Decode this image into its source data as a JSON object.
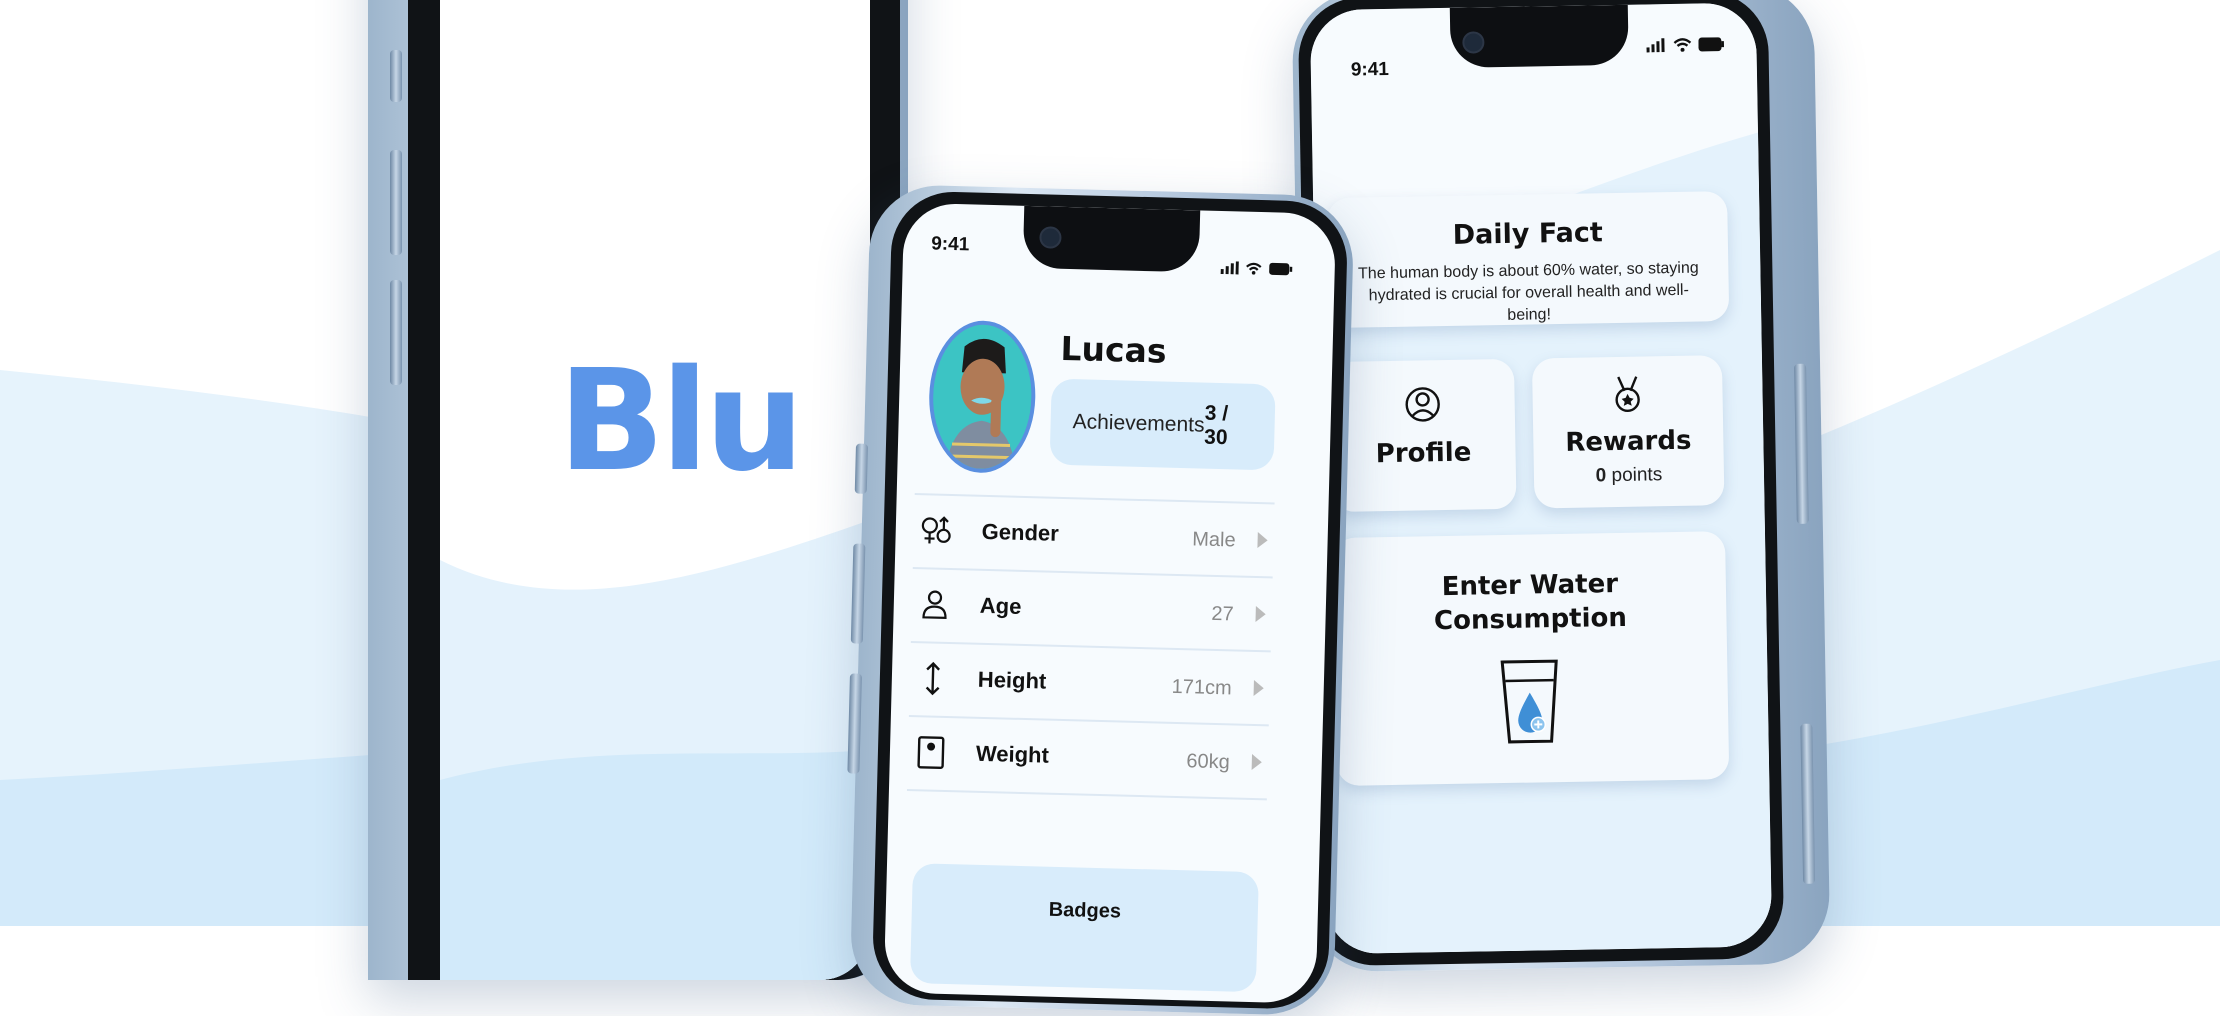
{
  "colors": {
    "accent": "#5b95e8",
    "light_blue": "#d8ecfb",
    "background_wave": "#e3f2fc"
  },
  "splash": {
    "logo_text": "Blu"
  },
  "profile_screen": {
    "status_time": "9:41",
    "user_name": "Lucas",
    "achievements": {
      "label": "Achievements",
      "value": "3 / 30"
    },
    "rows": [
      {
        "icon": "gender-icon",
        "label": "Gender",
        "value": "Male"
      },
      {
        "icon": "person-icon",
        "label": "Age",
        "value": "27"
      },
      {
        "icon": "height-arrows-icon",
        "label": "Height",
        "value": "171cm"
      },
      {
        "icon": "scale-icon",
        "label": "Weight",
        "value": "60kg"
      }
    ],
    "badges_label": "Badges"
  },
  "home_screen": {
    "status_time": "9:41",
    "daily_fact": {
      "title": "Daily Fact",
      "text": "The human body is about 60% water, so staying hydrated is crucial for overall health and well-being!"
    },
    "profile_card": {
      "label": "Profile",
      "icon": "profile-icon"
    },
    "rewards_card": {
      "label": "Rewards",
      "points_value": "0",
      "points_unit": " points",
      "icon": "medal-icon"
    },
    "water_card": {
      "title_line1": "Enter Water",
      "title_line2": "Consumption",
      "icon": "water-glass-icon"
    }
  }
}
